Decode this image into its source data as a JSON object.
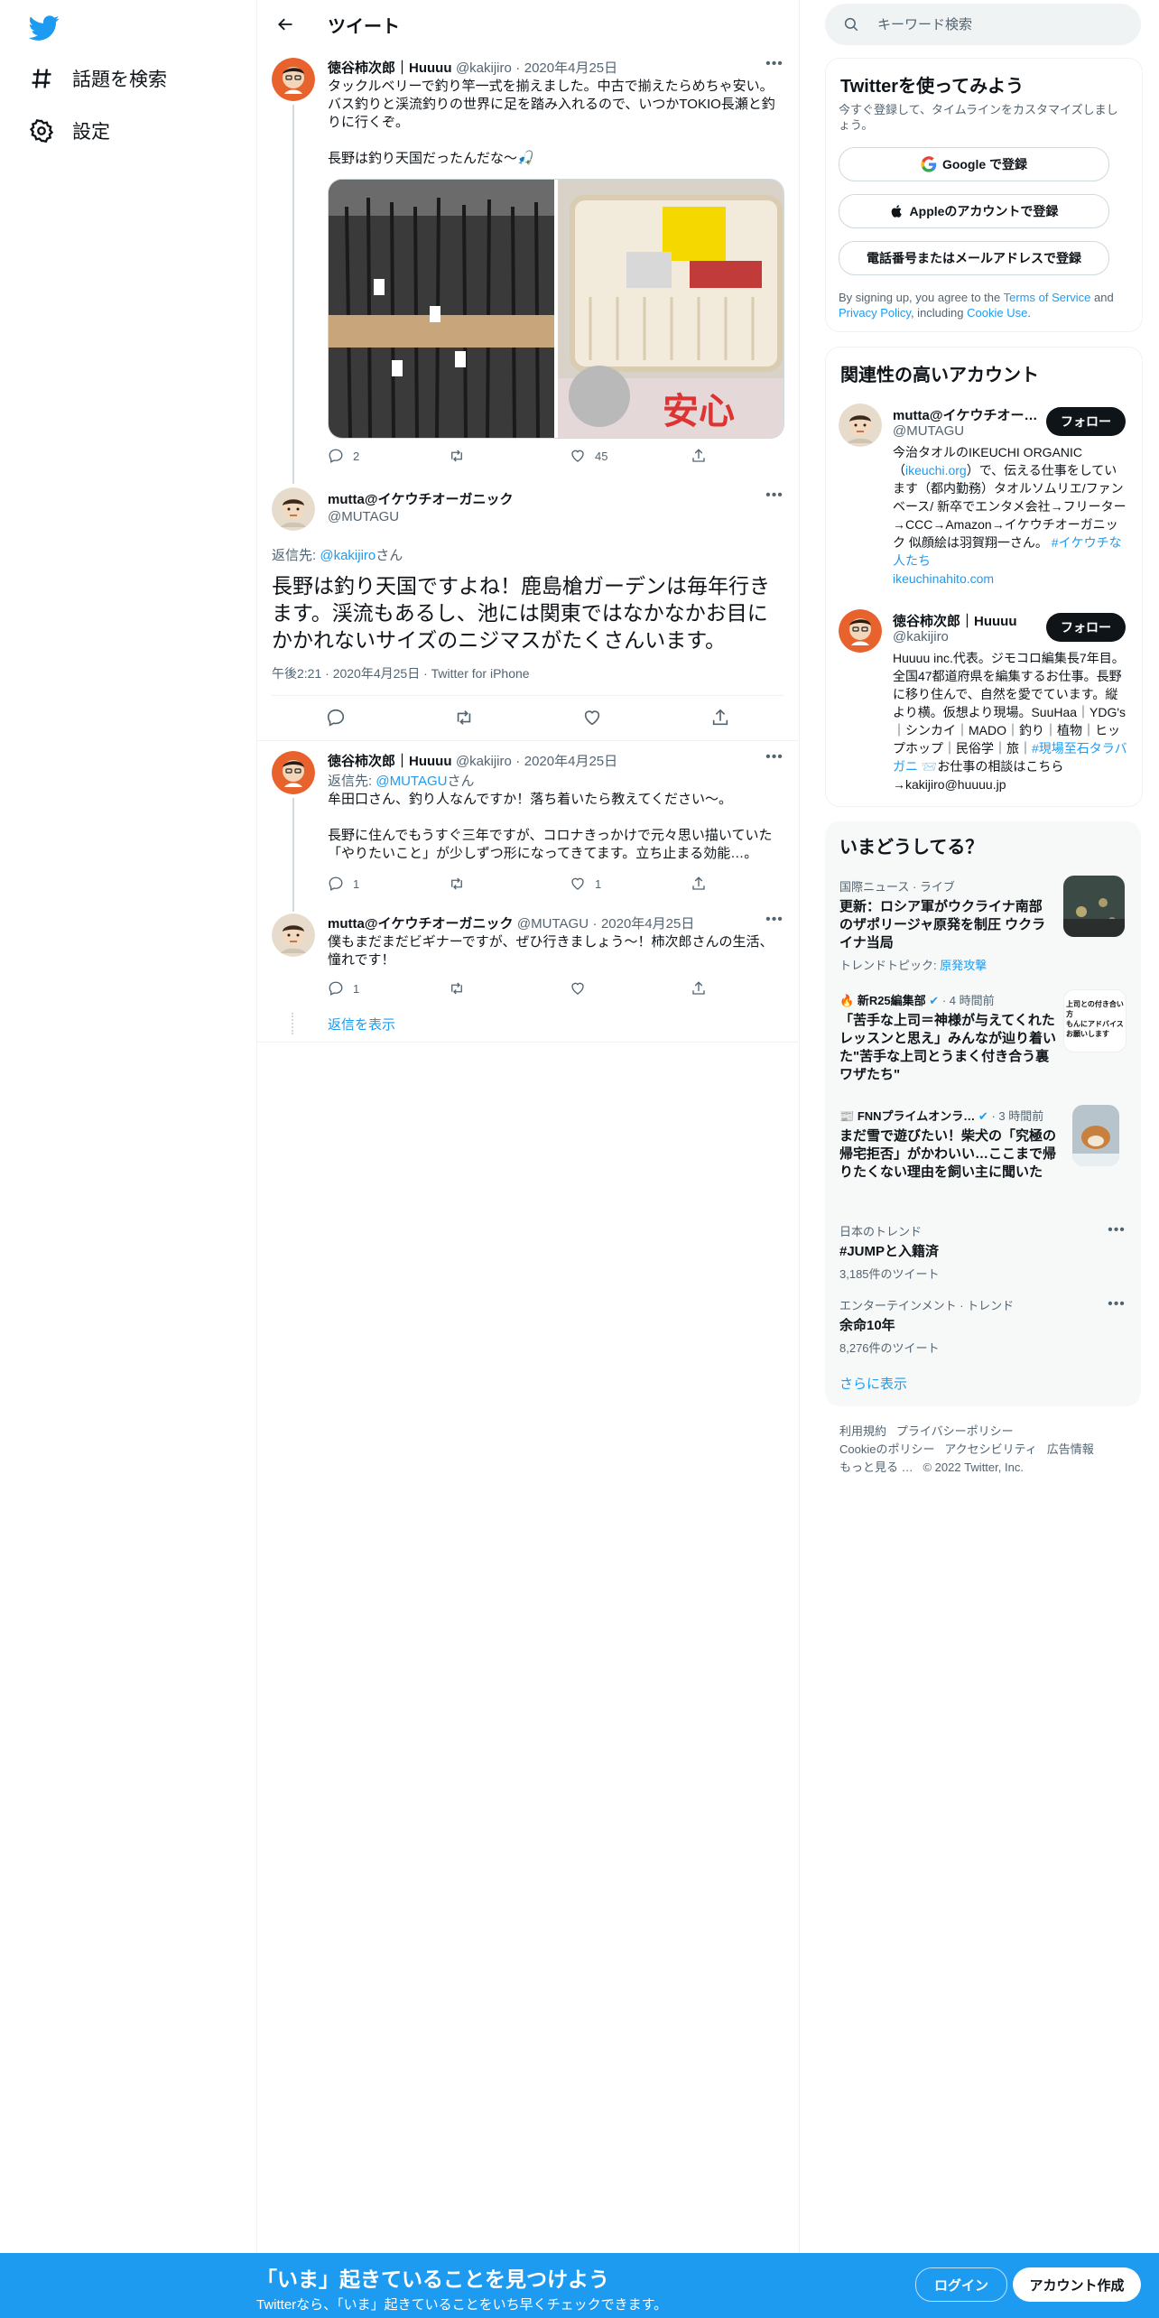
{
  "nav": {
    "logo_icon": "twitter-bird-icon",
    "items": [
      {
        "label": "話題を検索",
        "icon": "hashtag-icon"
      },
      {
        "label": "設定",
        "icon": "gear-icon"
      }
    ]
  },
  "main": {
    "title": "ツイート",
    "tweet1": {
      "name": "徳谷柿次郎｜Huuuu",
      "handle": "@kakijiro",
      "date": "2020年4月25日",
      "text": "タックルベリーで釣り竿一式を揃えました。中古で揃えたらめちゃ安い。バス釣りと渓流釣りの世界に足を踏み入れるので、いつかTOKIO長瀬と釣りに行くぞ。\n\n長野は釣り天国だったんだな〜🎣",
      "replies": "2",
      "retweets": "",
      "likes": "45"
    },
    "focus": {
      "name": "mutta@イケウチオーガニック",
      "handle": "@MUTAGU",
      "reply_to_prefix": "返信先: ",
      "reply_to_handle": "@kakijiro",
      "reply_to_suffix": "さん",
      "text": "長野は釣り天国ですよね！鹿島槍ガーデンは毎年行きます。渓流もあるし、池には関東ではなかなかお目にかかれないサイズのニジマスがたくさんいます。",
      "time": "午後2:21 · 2020年4月25日 · Twitter for iPhone"
    },
    "tweet3": {
      "name": "徳谷柿次郎｜Huuuu",
      "handle": "@kakijiro",
      "date": "2020年4月25日",
      "reply_to_prefix": "返信先: ",
      "reply_to_handle": "@MUTAGU",
      "reply_to_suffix": "さん",
      "text": "牟田口さん、釣り人なんですか！落ち着いたら教えてください〜。\n\n長野に住んでもうすぐ三年ですが、コロナきっかけで元々思い描いていた「やりたいこと」が少しずつ形になってきてます。立ち止まる効能…。",
      "replies": "1",
      "retweets": "",
      "likes": "1"
    },
    "tweet4": {
      "name": "mutta@イケウチオーガニック",
      "handle": "@MUTAGU",
      "date": "2020年4月25日",
      "text": "僕もまだまだビギナーですが、ぜひ行きましょう〜！柿次郎さんの生活、憧れです！",
      "replies": "1",
      "retweets": "",
      "likes": ""
    },
    "show_replies": "返信を表示"
  },
  "right": {
    "search_placeholder": "キーワード検索",
    "signup": {
      "title": "Twitterを使ってみよう",
      "desc": "今すぐ登録して、タイムラインをカスタマイズしましょう。",
      "google": "Google で登録",
      "apple": "Appleのアカウントで登録",
      "phone": "電話番号またはメールアドレスで登録",
      "legal_1": "By signing up, you agree to the ",
      "tos": "Terms of Service",
      "legal_2": " and ",
      "privacy": "Privacy Policy",
      "legal_3": ", including ",
      "cookie": "Cookie Use",
      "legal_4": "."
    },
    "relevant": {
      "title": "関連性の高いアカウント",
      "follow": "フォロー",
      "accounts": [
        {
          "name": "mutta@イケウチオー…",
          "handle": "@MUTAGU",
          "bio_1": "今治タオルのIKEUCHI ORGANIC（",
          "bio_link1": "ikeuchi.org",
          "bio_2": "）で、伝える仕事をしています（都内勤務）タオルソムリエ/ファンベース/ 新卒でエンタメ会社→フリーター→CCC→Amazon→イケウチオーガニック 似顔絵は羽賀翔一さん。 ",
          "bio_link2": "#イケウチな人たち",
          "bio_link3": "ikeuchinahito.com"
        },
        {
          "name": "徳谷柿次郎｜Huuuu",
          "handle": "@kakijiro",
          "bio_1": "Huuuu inc.代表。ジモコロ編集長7年目。全国47都道府県を編集するお仕事。長野に移り住んで、自然を愛でています。縦より横。仮想より現場。SuuHaa｜YDG's｜シンカイ｜MADO｜釣り｜植物｜ヒップホップ｜民俗学｜旅｜",
          "bio_link": "#現場至石タラバガニ",
          "bio_2": " 📨お仕事の相談はこちら→kakijiro@huuuu.jp"
        }
      ]
    },
    "trends": {
      "title": "いまどうしてる？",
      "items": [
        {
          "category": "国際ニュース · ライブ",
          "title": "更新：ロシア軍がウクライナ南部のザポリージャ原発を制圧 ウクライナ当局",
          "sub_prefix": "トレンドトピック: ",
          "sub_link": "原発攻撃"
        },
        {
          "source": "新R25編集部",
          "time": "· 4 時間前",
          "title": "「苦手な上司＝神様が与えてくれたレッスンと思え」みんなが辿り着いた\"苦手な上司とうまく付き合う裏ワザたち\"",
          "thumb_text": "上司との付き合い方\nもんにアドバイスお願いします"
        },
        {
          "source": "FNNプライムオンラ…",
          "time": "· 3 時間前",
          "title": "まだ雪で遊びたい！柴犬の「究極の帰宅拒否」がかわいい…ここまで帰りたくない理由を飼い主に聞いた"
        },
        {
          "category": "日本のトレンド",
          "title": "#JUMPと入籍済",
          "sub": "3,185件のツイート"
        },
        {
          "category": "エンターテインメント · トレンド",
          "title": "余命10年",
          "sub": "8,276件のツイート"
        }
      ],
      "show_more": "さらに表示"
    },
    "footer": {
      "links": [
        "利用規約",
        "プライバシーポリシー",
        "Cookieのポリシー",
        "アクセシビリティ",
        "広告情報",
        "もっと見る …"
      ],
      "copyright": "© 2022 Twitter, Inc."
    }
  },
  "bottom": {
    "title": "「いま」起きていることを見つけよう",
    "sub": "Twitterなら、「いま」起きていることをいち早くチェックできます。",
    "login": "ログイン",
    "signup": "アカウント作成"
  },
  "colors": {
    "accent": "#1d9bf0",
    "text": "#0f1419",
    "muted": "#536471",
    "border": "#eff3f4"
  }
}
